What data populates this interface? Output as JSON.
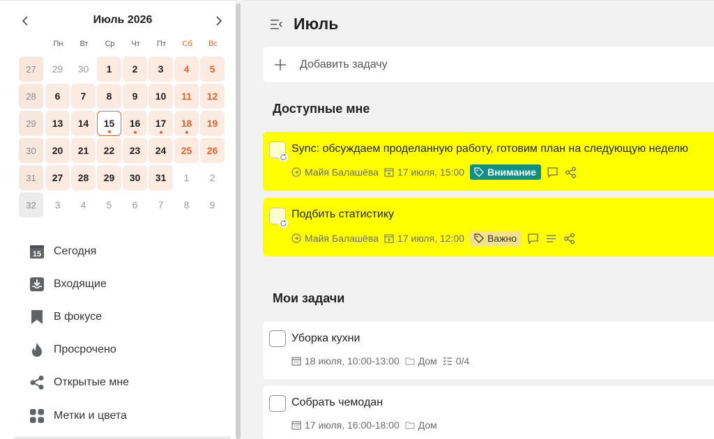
{
  "calendar": {
    "title": "Июль 2026",
    "weekdays": [
      "Пн",
      "Вт",
      "Ср",
      "Чт",
      "Пт",
      "Сб",
      "Вс"
    ],
    "weeks": [
      {
        "num": "27",
        "days": [
          "29",
          "30",
          "1",
          "2",
          "3",
          "4",
          "5"
        ]
      },
      {
        "num": "28",
        "days": [
          "6",
          "7",
          "8",
          "9",
          "10",
          "11",
          "12"
        ]
      },
      {
        "num": "29",
        "days": [
          "13",
          "14",
          "15",
          "16",
          "17",
          "18",
          "19"
        ]
      },
      {
        "num": "30",
        "days": [
          "20",
          "21",
          "22",
          "23",
          "24",
          "25",
          "26"
        ]
      },
      {
        "num": "31",
        "days": [
          "27",
          "28",
          "29",
          "30",
          "31",
          "1",
          "2"
        ]
      },
      {
        "num": "32",
        "days": [
          "3",
          "4",
          "5",
          "6",
          "7",
          "8",
          "9"
        ]
      }
    ]
  },
  "nav": [
    {
      "label": "Сегодня",
      "icon": "calendar-today-icon"
    },
    {
      "label": "Входящие",
      "icon": "inbox-icon"
    },
    {
      "label": "В фокусе",
      "icon": "bookmark-icon"
    },
    {
      "label": "Просрочено",
      "icon": "flame-icon"
    },
    {
      "label": "Открытые мне",
      "icon": "share-icon"
    },
    {
      "label": "Метки и цвета",
      "icon": "grid-icon"
    }
  ],
  "main": {
    "title": "Июль",
    "add_task_label": "Добавить задачу",
    "sections": {
      "shared": {
        "title": "Доступные мне",
        "tasks": [
          {
            "title": "Sync: обсуждаем проделанную работу, готовим план на следующую неделю",
            "owner": "Майя Балашёва",
            "date": "17 июля, 15:00",
            "tag": "Внимание"
          },
          {
            "title": "Подбить статистику",
            "owner": "Майя Балашёва",
            "date": "17 июля, 12:00",
            "tag": "Важно"
          }
        ]
      },
      "mine": {
        "title": "Мои задачи",
        "tasks": [
          {
            "title": "Уборка кухни",
            "date": "18 июля, 10:00-13:00",
            "project": "Дом",
            "checklist": "0/4"
          },
          {
            "title": "Собрать чемодан",
            "date": "17 июля, 16:00-18:00",
            "project": "Дом"
          }
        ]
      }
    }
  },
  "colors": {
    "accent": "#e8622c",
    "highlight": "#ffff00",
    "tag_attention": "#0f8f86",
    "tag_important": "#f3e28a"
  }
}
